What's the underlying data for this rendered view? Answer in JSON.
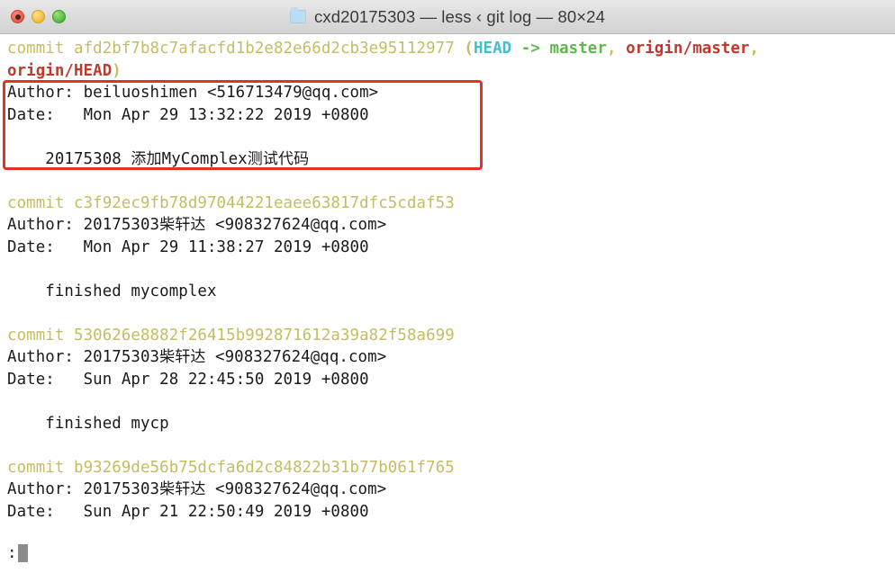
{
  "window": {
    "title": "cxd20175303 — less ‹ git log — 80×24",
    "folder_icon": "folder-icon",
    "controls": {
      "close_label": "close",
      "minimize_label": "minimize",
      "zoom_label": "zoom"
    }
  },
  "terminal": {
    "command": "git log",
    "pager": "less",
    "size": "80×24",
    "colors": {
      "hash": "#c6bc62",
      "head": "#3fc0cf",
      "branch_local": "#5fb84f",
      "branch_remote": "#c0392b",
      "text": "#1a1a1a",
      "background": "#ffffff",
      "annotation": "#e03326",
      "cursor": "#8c8c8c"
    },
    "prompt": ":",
    "commits": [
      {
        "label_commit": "commit ",
        "hash": "afd2bf7b8c7afacfd1b2e82e66d2cb3e95112977",
        "refs_open": " (",
        "ref_head": "HEAD",
        "ref_arrow": " -> ",
        "ref_master": "master",
        "ref_sep1": ", ",
        "ref_origin_master": "origin/master",
        "ref_sep2": ",",
        "ref_origin_head": "origin/HEAD",
        "refs_close": ")",
        "author_label": "Author: ",
        "author": "beiluoshimen <516713479@qq.com>",
        "date_label": "Date:   ",
        "date": "Mon Apr 29 13:32:22 2019 +0800",
        "message_indent": "    ",
        "message_ascii": "20175308 ",
        "message_cjk_1": "添加",
        "message_mid": "MyComplex",
        "message_cjk_2": "测试代码",
        "highlighted": true
      },
      {
        "label_commit": "commit ",
        "hash": "c3f92ec9fb78d97044221eaee63817dfc5cdaf53",
        "author_label": "Author: ",
        "author_ascii": "20175303",
        "author_cjk": "柴轩达",
        "author_email": " <908327624@qq.com>",
        "date_label": "Date:   ",
        "date": "Mon Apr 29 11:38:27 2019 +0800",
        "message_indent": "    ",
        "message": "finished mycomplex",
        "highlighted": false
      },
      {
        "label_commit": "commit ",
        "hash": "530626e8882f26415b992871612a39a82f58a699",
        "author_label": "Author: ",
        "author_ascii": "20175303",
        "author_cjk": "柴轩达",
        "author_email": " <908327624@qq.com>",
        "date_label": "Date:   ",
        "date": "Sun Apr 28 22:45:50 2019 +0800",
        "message_indent": "    ",
        "message": "finished mycp",
        "highlighted": false
      },
      {
        "label_commit": "commit ",
        "hash": "b93269de56b75dcfa6d2c84822b31b77b061f765",
        "author_label": "Author: ",
        "author_ascii": "20175303",
        "author_cjk": "柴轩达",
        "author_email": " <908327624@qq.com>",
        "date_label": "Date:   ",
        "date": "Sun Apr 21 22:50:49 2019 +0800",
        "highlighted": false
      }
    ]
  }
}
